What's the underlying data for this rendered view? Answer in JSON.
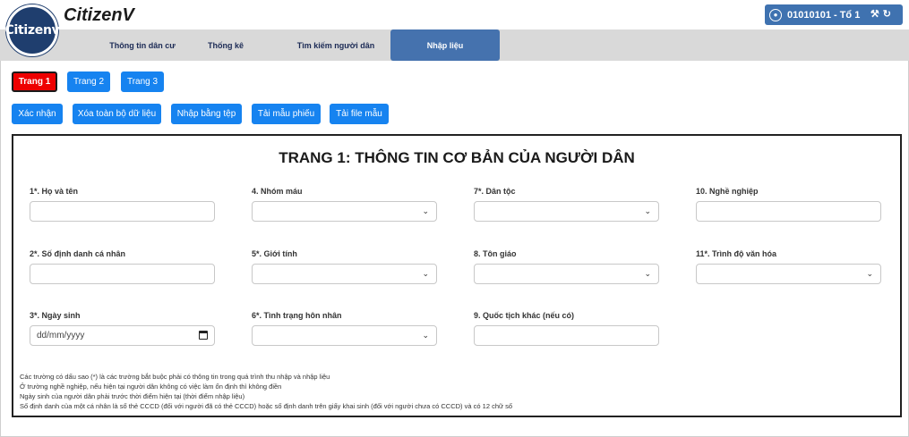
{
  "app": {
    "logo_text": "Citizenv",
    "title": "CitizenV"
  },
  "user": {
    "label": "01010101 - Tổ 1",
    "icon": "user-circle-icon",
    "tools_icons": [
      "tools-icon",
      "logout-icon"
    ]
  },
  "nav": {
    "items": [
      {
        "label": "Thông tin dân cư"
      },
      {
        "label": "Thống kê"
      },
      {
        "label": "Tìm kiếm người dân"
      },
      {
        "label": "Nhập liệu"
      }
    ]
  },
  "pages": [
    "Trang 1",
    "Trang 2",
    "Trang 3"
  ],
  "actions": [
    "Xác nhận",
    "Xóa toàn bộ dữ liệu",
    "Nhập bằng tệp",
    "Tải mẫu phiếu",
    "Tải file mẫu"
  ],
  "form": {
    "title": "TRANG 1: THÔNG TIN CƠ BẢN CỦA NGƯỜI DÂN",
    "fields": {
      "ho_ten": "1*. Họ và tên",
      "nhom_mau": "4. Nhóm máu",
      "dan_toc": "7*. Dân tộc",
      "nghe_nghiep": "10. Nghề nghiệp",
      "so_dinh_danh": "2*. Số định danh cá nhân",
      "gioi_tinh": "5*. Giới tính",
      "ton_giao": "8. Tôn giáo",
      "trinh_do": "11*. Trình độ văn hóa",
      "ngay_sinh": "3*. Ngày sinh",
      "hon_nhan": "6*. Tình trạng hôn nhân",
      "quoc_tich": "9. Quốc tịch khác (nếu có)"
    },
    "date_placeholder": "dd/mm/yyyy",
    "notes": [
      "Các trường có dấu sao (*) là các trường bắt buộc phải có thông tin trong quá trình thu nhập và nhập liệu",
      "Ở trường nghề nghiệp, nếu hiện tại người dân không có việc làm ổn định thì không điền",
      "Ngày sinh của người dân phải trước thời điểm hiện tại (thời điểm nhập liệu)",
      "Số định danh của một cá nhân là số thẻ CCCD (đối với người đã có thẻ CCCD) hoặc số định danh trên giấy khai sinh (đối với người chưa có CCCD) và có 12 chữ số"
    ]
  },
  "colors": {
    "primary": "#1683f0",
    "nav_active": "#4572ae",
    "active_page": "#ee0000",
    "logo": "#1f3e6e"
  }
}
